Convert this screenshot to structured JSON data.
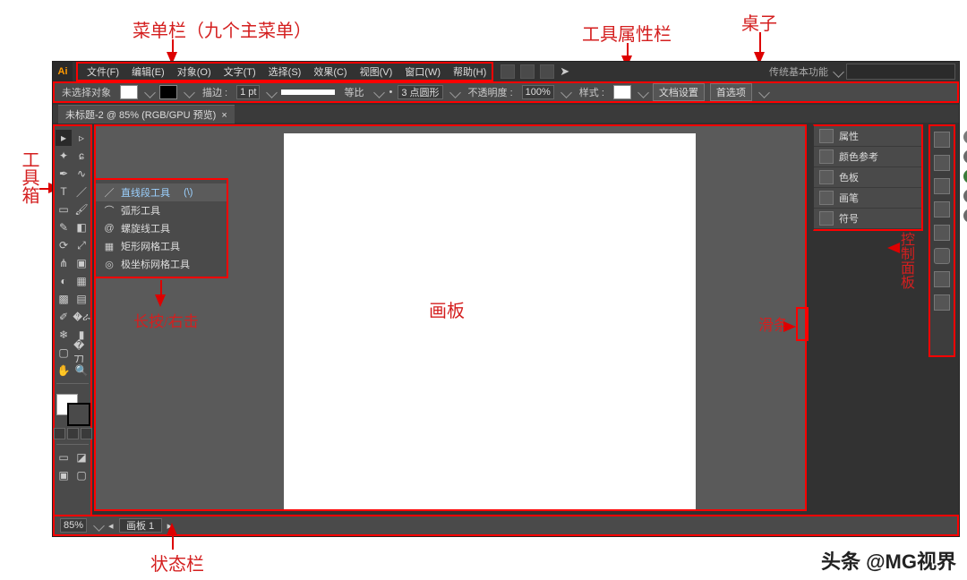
{
  "appbar": {
    "logo": "Ai",
    "workspace": "传统基本功能",
    "search_placeholder": ""
  },
  "menus": [
    "文件(F)",
    "编辑(E)",
    "对象(O)",
    "文字(T)",
    "选择(S)",
    "效果(C)",
    "视图(V)",
    "窗口(W)",
    "帮助(H)"
  ],
  "properties": {
    "no_selection": "未选择对象",
    "stroke_label": "描边 :",
    "stroke_weight": "1 pt",
    "uniform": "等比",
    "dash_value": "3 点圆形",
    "opacity_label": "不透明度 :",
    "opacity_value": "100%",
    "style_label": "样式 :",
    "doc_setup": "文档设置",
    "prefs": "首选项"
  },
  "tab": {
    "title": "未标题-2 @ 85% (RGB/GPU 预览)"
  },
  "flyout": {
    "items": [
      {
        "icon": "line-icon",
        "label": "直线段工具",
        "shortcut": "(\\)",
        "selected": true
      },
      {
        "icon": "arc-icon",
        "label": "弧形工具"
      },
      {
        "icon": "spiral-icon",
        "label": "螺旋线工具"
      },
      {
        "icon": "rect-grid-icon",
        "label": "矩形网格工具"
      },
      {
        "icon": "polar-grid-icon",
        "label": "极坐标网格工具"
      }
    ]
  },
  "right_panels": [
    {
      "icon": "properties-icon",
      "label": "属性"
    },
    {
      "icon": "color-guide-icon",
      "label": "颜色参考"
    },
    {
      "icon": "swatches-icon",
      "label": "色板"
    },
    {
      "icon": "brushes-icon",
      "label": "画笔"
    },
    {
      "icon": "symbols-icon",
      "label": "符号"
    }
  ],
  "status": {
    "zoom": "85%",
    "nav": "画板 1"
  },
  "annotations": {
    "menubar": "菜单栏（九个主菜单）",
    "propbar": "工具属性栏",
    "desktop": "桌子",
    "toolbox": "工具箱",
    "flyout_hint": "长按/右击",
    "artboard": "画板",
    "slider": "滑条",
    "panel_stack": "控制面板",
    "statusbar": "状态栏"
  },
  "watermark": "头条 @MG视界"
}
